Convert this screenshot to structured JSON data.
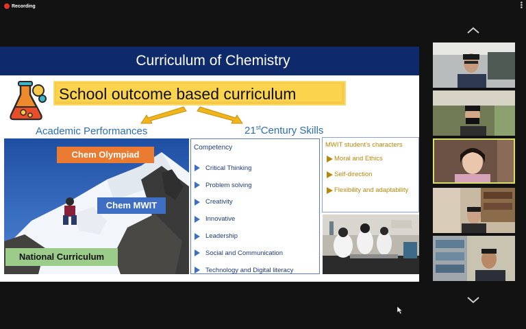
{
  "recording": {
    "label": "Recording"
  },
  "slide": {
    "title": "Curriculum of Chemistry",
    "outcome_heading": "School outcome based curriculum",
    "academic_label": "Academic Performances",
    "skills_prefix": "21",
    "skills_sup": "st",
    "skills_label": "Century Skills",
    "photo_tags": {
      "olympiad": "Chem Olympiad",
      "mwit": "Chem MWIT",
      "national": "National Curriculum"
    },
    "competency": {
      "title": "Competency",
      "items": [
        "Critical Thinking",
        "Problem solving",
        "Creativity",
        "Innovative",
        "Leadership",
        "Social and Communication",
        "Technology and Digital literacy"
      ]
    },
    "characters": {
      "title": "MWIT student’s characters",
      "items": [
        "Moral and Ethics",
        "Self-direction",
        "Flexibility and adaptability"
      ]
    }
  },
  "participants": {
    "count_visible": 5,
    "active_index": 2
  },
  "colors": {
    "header": "#0f2a6b",
    "accent_blue": "#3f6fc5",
    "accent_gold": "#b8860b",
    "highlight": "#fbd34d",
    "active_tile_border": "#d8e06a",
    "recording_dot": "#e5322d"
  },
  "icons": [
    "recording-dot-icon",
    "more-options-icon",
    "flask-icon",
    "chevron-up-icon",
    "chevron-down-icon",
    "mouse-cursor-icon"
  ]
}
